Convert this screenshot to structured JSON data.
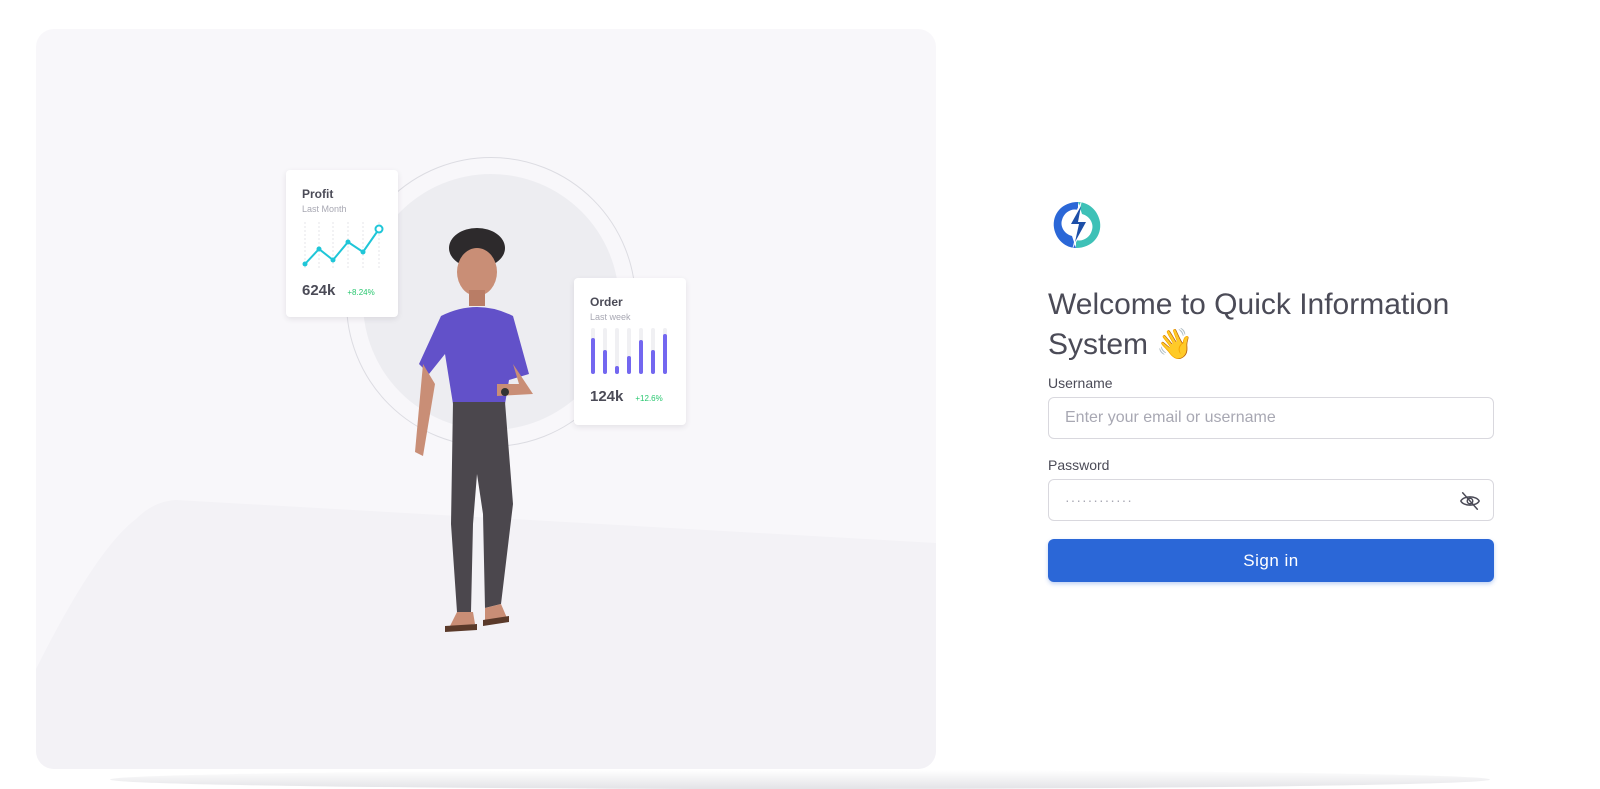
{
  "illustration": {
    "profit_card": {
      "title": "Profit",
      "subtitle": "Last Month",
      "value": "624k",
      "trend": "+8.24%",
      "line_color": "#1fc6d8"
    },
    "order_card": {
      "title": "Order",
      "subtitle": "Last week",
      "value": "124k",
      "trend": "+12.6%",
      "bar_color": "#7367f0"
    }
  },
  "form": {
    "welcome_title": "Welcome to Quick Information System 👋",
    "username_label": "Username",
    "username_placeholder": "Enter your email or username",
    "password_label": "Password",
    "password_value": "············",
    "eye_icon": "eye-off-icon",
    "signin_label": "Sign in"
  },
  "colors": {
    "primary": "#2b67d7",
    "text": "#4b4b57",
    "panel_bg": "#f8f7fa"
  }
}
